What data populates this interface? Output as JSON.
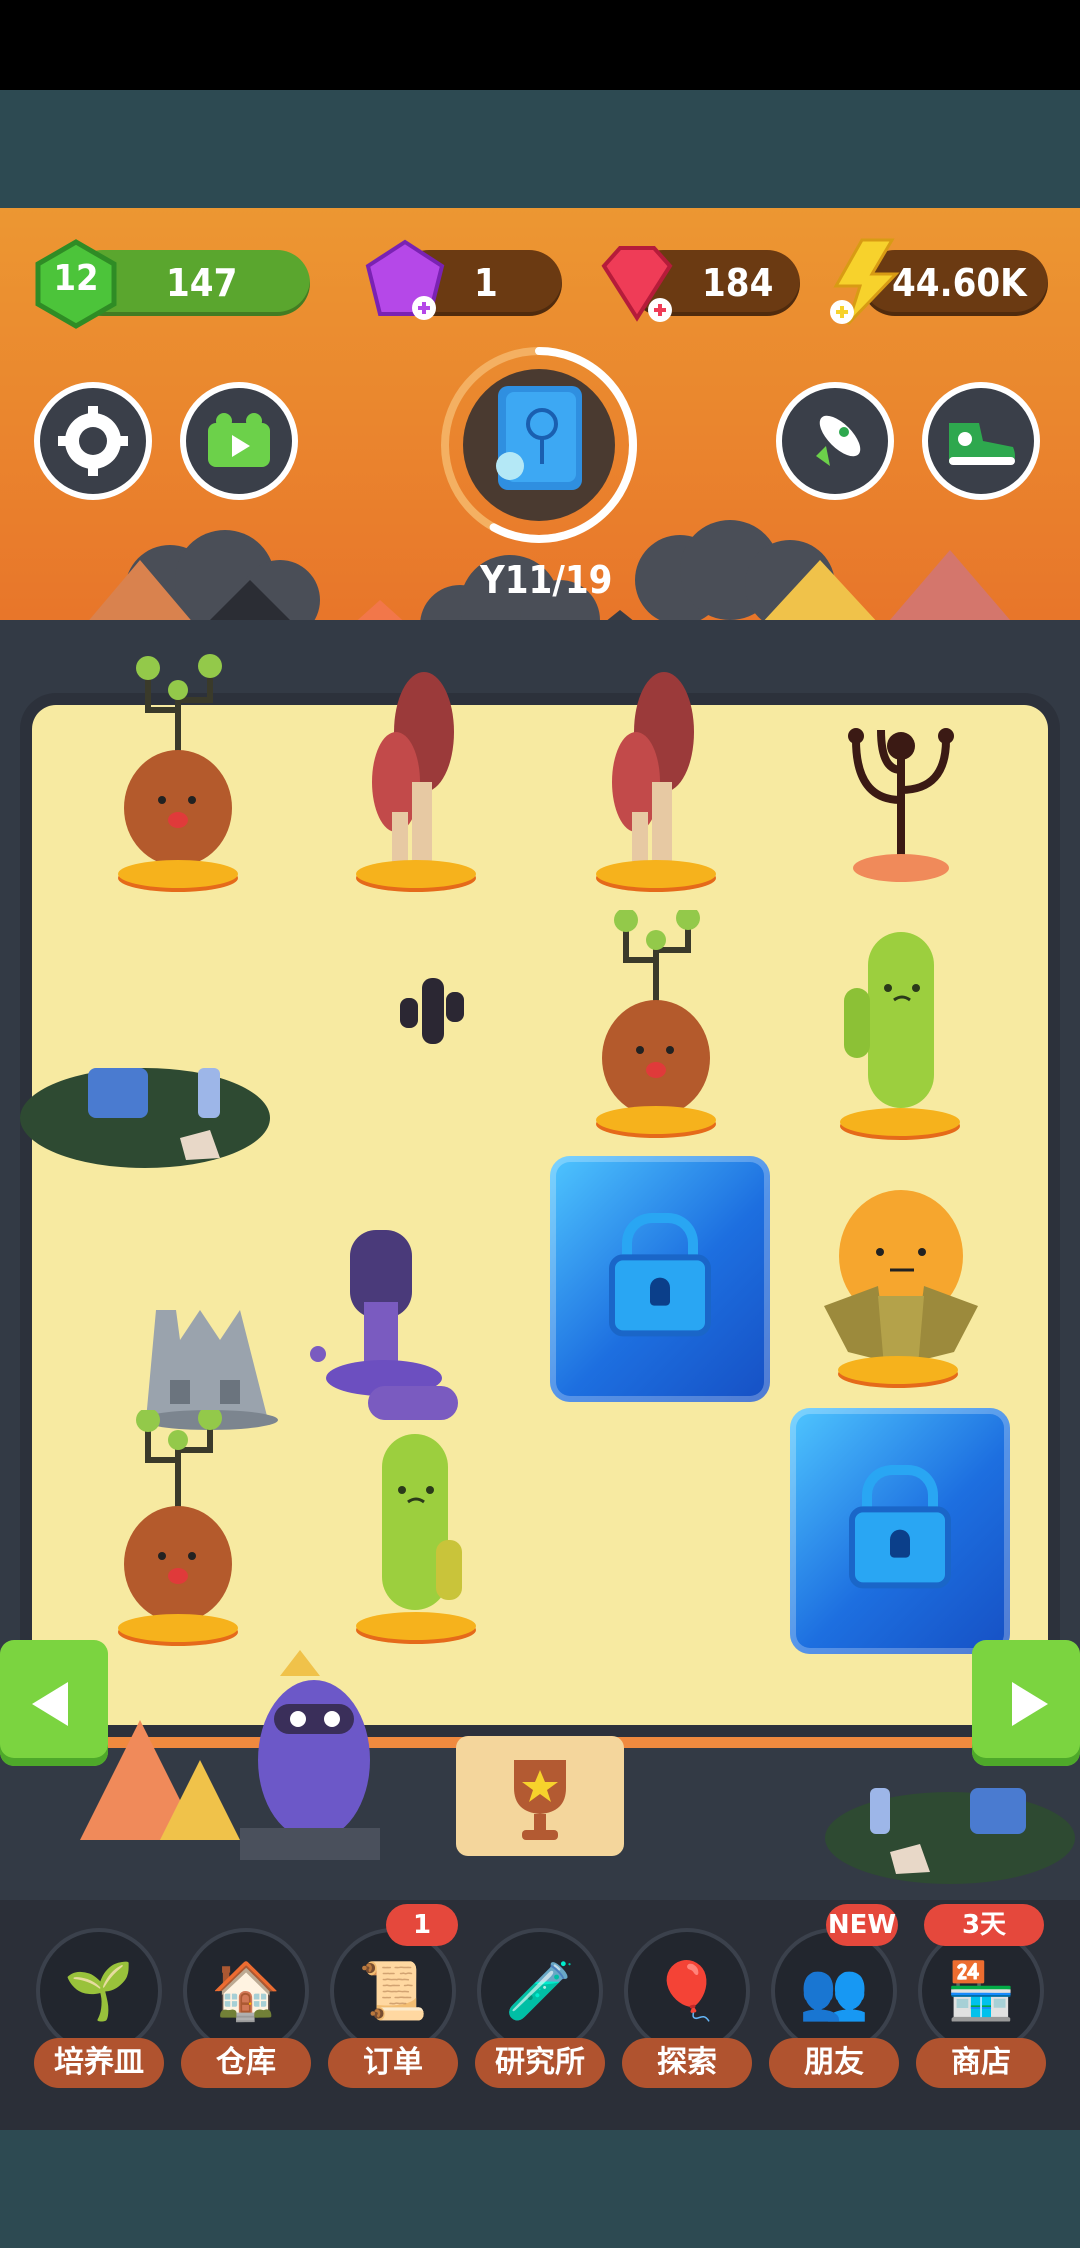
{
  "hud": {
    "level": "12",
    "xp": "147",
    "purple_gems": "1",
    "red_gems": "184",
    "energy": "44.60K"
  },
  "progress": {
    "label": "11/19",
    "value": 0.58
  },
  "nav": {
    "items": [
      {
        "label": "培养皿",
        "icon": "sprout-dish-icon"
      },
      {
        "label": "仓库",
        "icon": "barn-icon"
      },
      {
        "label": "订单",
        "icon": "scroll-icon",
        "badge": "1"
      },
      {
        "label": "研究所",
        "icon": "lab-icon"
      },
      {
        "label": "探索",
        "icon": "hot-air-balloon-icon"
      },
      {
        "label": "朋友",
        "icon": "friends-icon",
        "badge": "NEW"
      },
      {
        "label": "商店",
        "icon": "shop-icon",
        "badge": "3天"
      }
    ]
  },
  "colors": {
    "sky": "#ec9732",
    "field": "#f7eaa1",
    "accent_green": "#7bd440",
    "nav_label": "#b0532f",
    "badge_red": "#e5483c"
  }
}
